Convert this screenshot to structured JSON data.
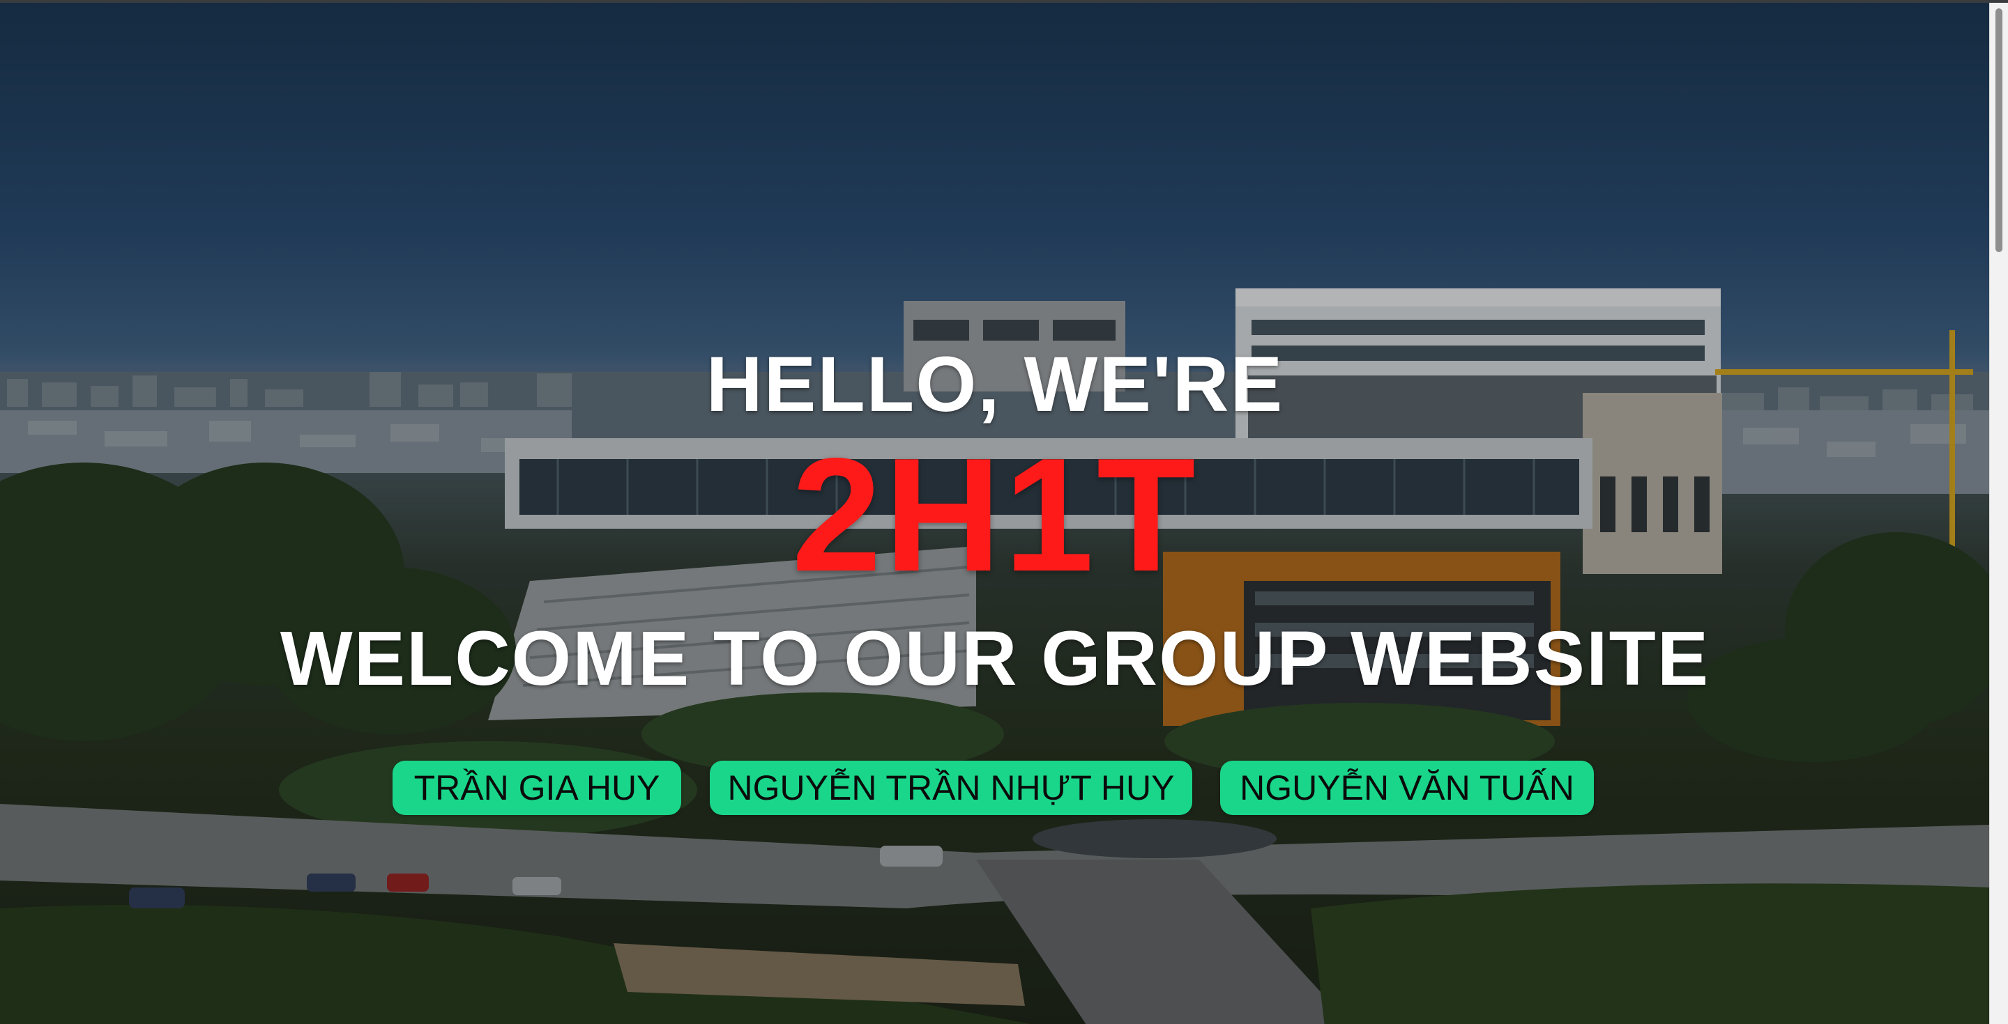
{
  "hero": {
    "greeting": "HELLO, WE'RE",
    "brand": "2H1T",
    "welcome": "WELCOME TO OUR GROUP WEBSITE",
    "brand_color": "#ff1a1a",
    "button_color": "#19d68a"
  },
  "members": [
    {
      "name": "TRẦN GIA HUY"
    },
    {
      "name": "NGUYỄN TRẦN NHỰT HUY"
    },
    {
      "name": "NGUYỄN VĂN TUẤN"
    }
  ]
}
